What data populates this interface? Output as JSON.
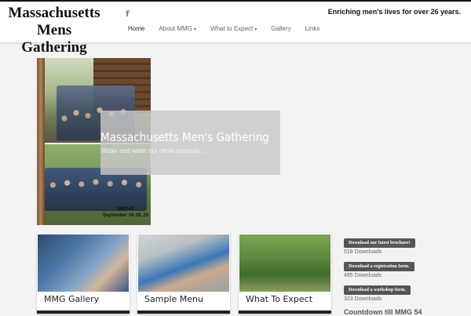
{
  "site": {
    "title_line1": "Massachusetts",
    "title_line2": "Mens Gathering",
    "tagline": "Enriching men's lives for over 26 years.",
    "facebook_glyph": "f"
  },
  "nav": {
    "items": [
      {
        "label": "Home",
        "active": true
      },
      {
        "label": "About MMG",
        "caret": "▾"
      },
      {
        "label": "What to Expect",
        "caret": "▾"
      },
      {
        "label": "Gallery"
      },
      {
        "label": "Links"
      }
    ]
  },
  "slider": {
    "title": "Massachusetts Men's Gathering",
    "subtitle": "Wider and wider our circle expands...",
    "photo_caption_line1": "MMG45",
    "photo_caption_line2": "September 16-18, 20"
  },
  "cards": [
    {
      "title": "MMG Gallery"
    },
    {
      "title": "Sample Menu"
    },
    {
      "title": "What To Expect"
    }
  ],
  "downloads": [
    {
      "label": "Download our latest brochure!",
      "count": "518 Downloads"
    },
    {
      "label": "Download a registration form.",
      "count": "495 Downloads"
    },
    {
      "label": "Download a workshop form.",
      "count": "323 Downloads"
    }
  ],
  "countdown": "Countdown till MMG 54",
  "icons": {
    "facebook": "facebook-icon",
    "caret": "chevron-down-icon"
  }
}
